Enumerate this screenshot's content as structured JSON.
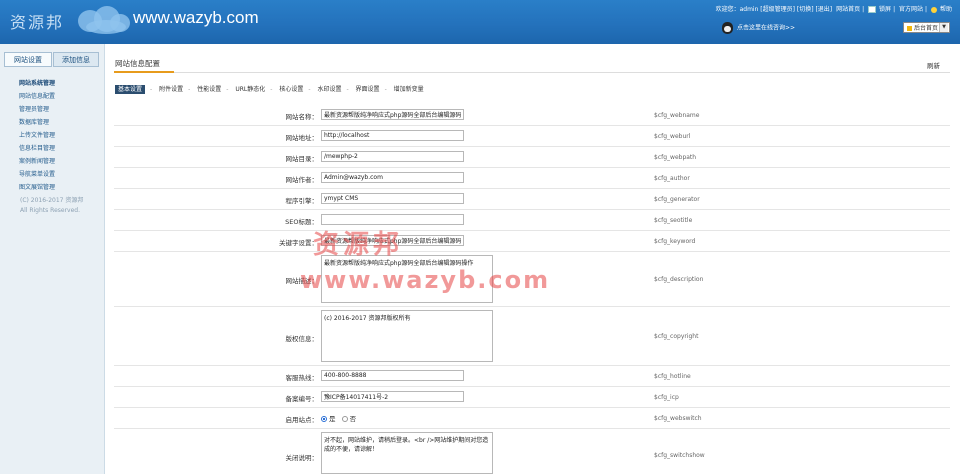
{
  "header": {
    "logo_text": "资源邦",
    "site_url": "www.wazyb.com",
    "welcome": "欢迎您：admin [超级管理员] [切换] [退出]",
    "links": [
      "网站首页",
      "锁屏",
      "官方网站",
      "帮助"
    ],
    "notice": "点击这里在线咨询>>",
    "home_select": "后台首页"
  },
  "sidebar": {
    "tabs": [
      "网站设置",
      "添加信息"
    ],
    "menu_head": "网站系统管理",
    "items": [
      "网站信息配置",
      "管理员管理",
      "数据库管理",
      "上传文件管理",
      "信息栏目管理",
      "案例新闻管理",
      "导航菜单设置",
      "图文展馆管理"
    ],
    "copyright_1": "(C) 2016-2017 资源邦",
    "copyright_2": "All Rights Reserved."
  },
  "main": {
    "title": "网站信息配置",
    "refresh": "刷新",
    "subnav": [
      "基本设置",
      "附件设置",
      "性能设置",
      "URL静态化",
      "核心设置",
      "水印设置",
      "界面设置",
      "增加新变量"
    ]
  },
  "fields": [
    {
      "label": "网站名称：",
      "value": "最新资源帮版纯净响应式php源码全部后台编辑源码",
      "var": "$cfg_webname"
    },
    {
      "label": "网站地址：",
      "value": "http://localhost",
      "var": "$cfg_weburl"
    },
    {
      "label": "网站目录：",
      "value": "/mewphp-2",
      "var": "$cfg_webpath"
    },
    {
      "label": "网站作者：",
      "value": "Admin@wazyb.com",
      "var": "$cfg_author"
    },
    {
      "label": "程序引擎：",
      "value": "ymypt CMS",
      "var": "$cfg_generator"
    },
    {
      "label": "SEO标题：",
      "value": "",
      "var": "$cfg_seotitle"
    },
    {
      "label": "关键字设置：",
      "value": "最新资源帮版纯净响应式php源码全部后台编辑源码",
      "var": "$cfg_keyword"
    },
    {
      "label": "网站描述：",
      "value": "最新资源帮版纯净响应式php源码全部后台编辑源码操作",
      "var": "$cfg_description"
    },
    {
      "label": "版权信息：",
      "value": "(c) 2016-2017 资源邦版权所有",
      "var": "$cfg_copyright"
    },
    {
      "label": "客服热线：",
      "value": "400-800-8888",
      "var": "$cfg_hotline"
    },
    {
      "label": "备案编号：",
      "value": "豫ICP备14017411号-2",
      "var": "$cfg_icp"
    },
    {
      "label": "启用站点：",
      "var": "$cfg_webswitch",
      "yes": "是",
      "no": "否"
    },
    {
      "label": "关闭说明：",
      "value": "对不起，网站维护，请稍后登录。<br />网站维护期间对您造成的不便，请谅解！",
      "var": "$cfg_switchshow"
    }
  ],
  "watermark": {
    "line1": "资源邦",
    "line2": "www.wazyb.com"
  }
}
